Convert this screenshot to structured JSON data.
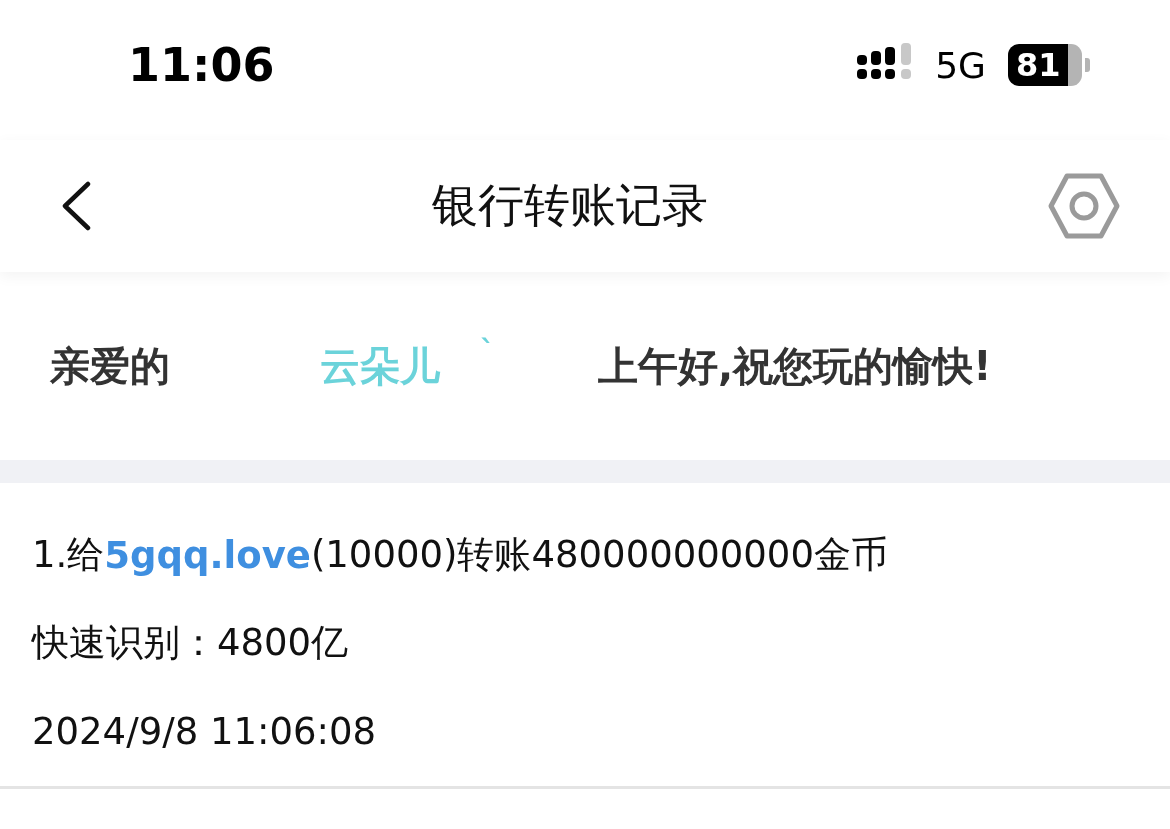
{
  "status_bar": {
    "time": "11:06",
    "network": "5G",
    "battery": "81"
  },
  "header": {
    "title": "银行转账记录"
  },
  "greeting": {
    "prefix": "亲爱的",
    "name": "云朵儿",
    "mark": "ˋ",
    "message": "上午好,祝您玩的愉快!"
  },
  "records": [
    {
      "prefix": "1.给",
      "link": "5gqq.love",
      "suffix": "(10000)转账480000000000金币",
      "quick": "快速识别：4800亿",
      "time": "2024/9/8 11:06:08"
    }
  ]
}
